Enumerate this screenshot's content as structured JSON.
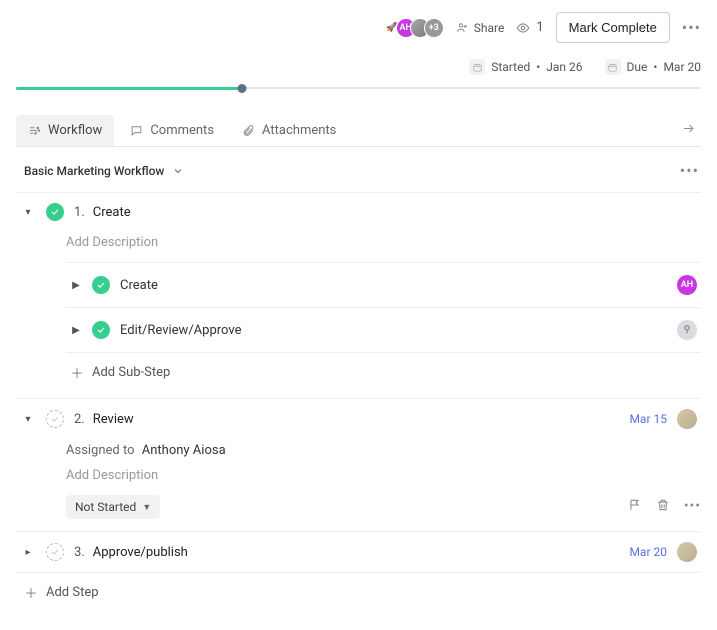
{
  "header": {
    "avatars": {
      "rocket": "🚀",
      "ah": "AH",
      "more": "+3"
    },
    "share_label": "Share",
    "watch_count": "1",
    "mark_complete_label": "Mark Complete",
    "started": {
      "prefix": "Started",
      "date": "Jan 26"
    },
    "due": {
      "prefix": "Due",
      "date": "Mar 20"
    }
  },
  "progress": {
    "percent": 33
  },
  "tabs": {
    "workflow": "Workflow",
    "comments": "Comments",
    "attachments": "Attachments"
  },
  "workflow": {
    "title": "Basic Marketing Workflow",
    "add_step_label": "Add Step",
    "add_substep_label": "Add Sub-Step",
    "add_desc_label": "Add Description",
    "assigned_to_label": "Assigned to",
    "steps": [
      {
        "num": "1.",
        "title": "Create",
        "status": "done",
        "expanded": true,
        "substeps": [
          {
            "title": "Create",
            "status": "done",
            "assignee": {
              "text": "AH",
              "bg": "#c739e0"
            }
          },
          {
            "title": "Edit/Review/Approve",
            "status": "done",
            "assignee": {
              "text": "",
              "bg": "#d9dbde"
            }
          }
        ]
      },
      {
        "num": "2.",
        "title": "Review",
        "status": "pending",
        "expanded": true,
        "due": "Mar 15",
        "assignee_name": "Anthony Aiosa",
        "status_btn": "Not Started"
      },
      {
        "num": "3.",
        "title": "Approve/publish",
        "status": "pending",
        "expanded": false,
        "due": "Mar 20"
      }
    ]
  }
}
